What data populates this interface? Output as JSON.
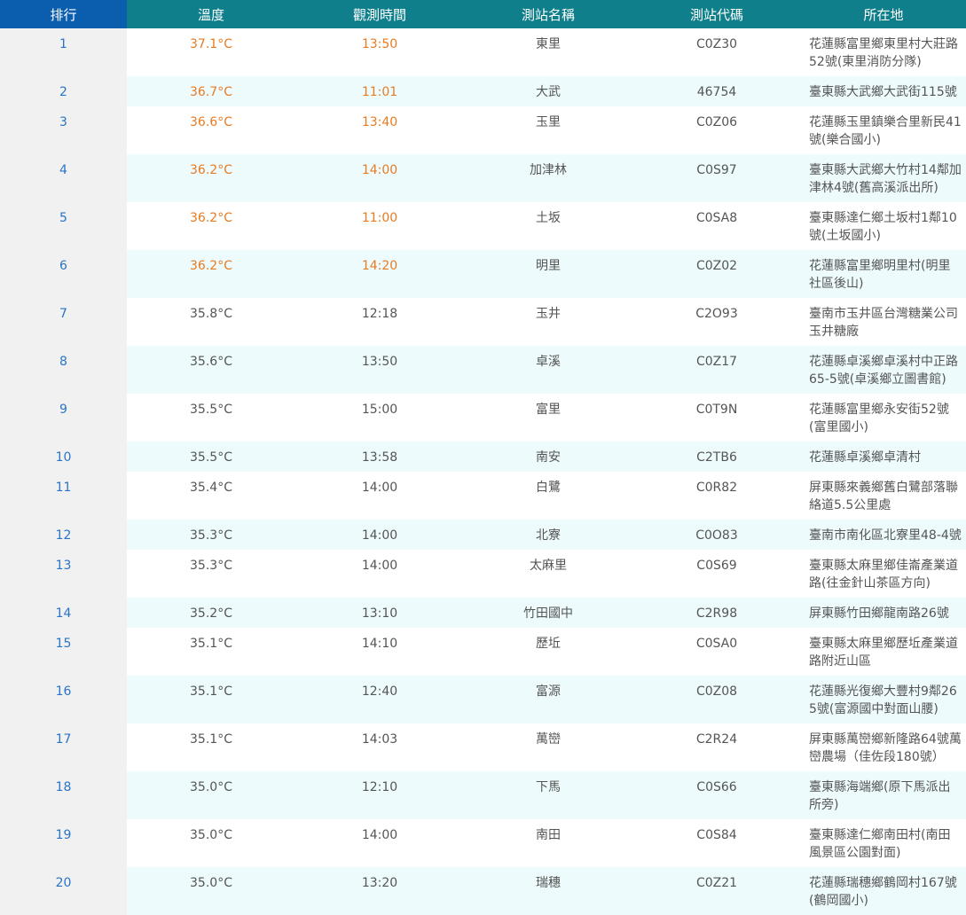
{
  "colors": {
    "rank_header_bg": "#0b5dae",
    "header_bg": "#0f7f8c",
    "rank_text": "#2a74c5",
    "highlight_text": "#e77b22",
    "stripe_bg": "#edfbfd"
  },
  "headers": {
    "rank": "排行",
    "temp": "溫度",
    "time": "觀測時間",
    "name": "測站名稱",
    "code": "測站代碼",
    "location": "所在地"
  },
  "rows": [
    {
      "rank": "1",
      "temp": "37.1°C",
      "time": "13:50",
      "name": "東里",
      "code": "C0Z30",
      "location": "花蓮縣富里鄉東里村大莊路52號(東里消防分隊)",
      "highlight": true
    },
    {
      "rank": "2",
      "temp": "36.7°C",
      "time": "11:01",
      "name": "大武",
      "code": "46754",
      "location": "臺東縣大武鄉大武街115號",
      "highlight": true
    },
    {
      "rank": "3",
      "temp": "36.6°C",
      "time": "13:40",
      "name": "玉里",
      "code": "C0Z06",
      "location": "花蓮縣玉里鎮樂合里新民41號(樂合國小)",
      "highlight": true
    },
    {
      "rank": "4",
      "temp": "36.2°C",
      "time": "14:00",
      "name": "加津林",
      "code": "C0S97",
      "location": "臺東縣大武鄉大竹村14鄰加津林4號(舊高溪派出所)",
      "highlight": true
    },
    {
      "rank": "5",
      "temp": "36.2°C",
      "time": "11:00",
      "name": "土坂",
      "code": "C0SA8",
      "location": "臺東縣達仁鄉土坂村1鄰10號(土坂國小)",
      "highlight": true
    },
    {
      "rank": "6",
      "temp": "36.2°C",
      "time": "14:20",
      "name": "明里",
      "code": "C0Z02",
      "location": "花蓮縣富里鄉明里村(明里社區後山)",
      "highlight": true
    },
    {
      "rank": "7",
      "temp": "35.8°C",
      "time": "12:18",
      "name": "玉井",
      "code": "C2O93",
      "location": "臺南市玉井區台灣糖業公司玉井糖廠",
      "highlight": false
    },
    {
      "rank": "8",
      "temp": "35.6°C",
      "time": "13:50",
      "name": "卓溪",
      "code": "C0Z17",
      "location": "花蓮縣卓溪鄉卓溪村中正路65-5號(卓溪鄉立圖書館)",
      "highlight": false
    },
    {
      "rank": "9",
      "temp": "35.5°C",
      "time": "15:00",
      "name": "富里",
      "code": "C0T9N",
      "location": "花蓮縣富里鄉永安街52號(富里國小)",
      "highlight": false
    },
    {
      "rank": "10",
      "temp": "35.5°C",
      "time": "13:58",
      "name": "南安",
      "code": "C2TB6",
      "location": "花蓮縣卓溪鄉卓清村",
      "highlight": false
    },
    {
      "rank": "11",
      "temp": "35.4°C",
      "time": "14:00",
      "name": "白鷺",
      "code": "C0R82",
      "location": "屏東縣來義鄉舊白鷺部落聯絡道5.5公里處",
      "highlight": false
    },
    {
      "rank": "12",
      "temp": "35.3°C",
      "time": "14:00",
      "name": "北寮",
      "code": "C0O83",
      "location": "臺南市南化區北寮里48-4號",
      "highlight": false
    },
    {
      "rank": "13",
      "temp": "35.3°C",
      "time": "14:00",
      "name": "太麻里",
      "code": "C0S69",
      "location": "臺東縣太麻里鄉佳崙產業道路(往金針山茶區方向)",
      "highlight": false
    },
    {
      "rank": "14",
      "temp": "35.2°C",
      "time": "13:10",
      "name": "竹田國中",
      "code": "C2R98",
      "location": "屏東縣竹田鄉龍南路26號",
      "highlight": false
    },
    {
      "rank": "15",
      "temp": "35.1°C",
      "time": "14:10",
      "name": "歷坵",
      "code": "C0SA0",
      "location": "臺東縣太麻里鄉歷坵產業道路附近山區",
      "highlight": false
    },
    {
      "rank": "16",
      "temp": "35.1°C",
      "time": "12:40",
      "name": "富源",
      "code": "C0Z08",
      "location": "花蓮縣光復鄉大豐村9鄰265號(富源國中對面山腰)",
      "highlight": false
    },
    {
      "rank": "17",
      "temp": "35.1°C",
      "time": "14:03",
      "name": "萬巒",
      "code": "C2R24",
      "location": "屏東縣萬巒鄉新隆路64號萬巒農場（佳佐段180號）",
      "highlight": false
    },
    {
      "rank": "18",
      "temp": "35.0°C",
      "time": "12:10",
      "name": "下馬",
      "code": "C0S66",
      "location": "臺東縣海端鄉(原下馬派出所旁)",
      "highlight": false
    },
    {
      "rank": "19",
      "temp": "35.0°C",
      "time": "14:00",
      "name": "南田",
      "code": "C0S84",
      "location": "臺東縣達仁鄉南田村(南田風景區公園對面)",
      "highlight": false
    },
    {
      "rank": "20",
      "temp": "35.0°C",
      "time": "13:20",
      "name": "瑞穗",
      "code": "C0Z21",
      "location": "花蓮縣瑞穗鄉鶴岡村167號(鶴岡國小)",
      "highlight": false
    }
  ]
}
